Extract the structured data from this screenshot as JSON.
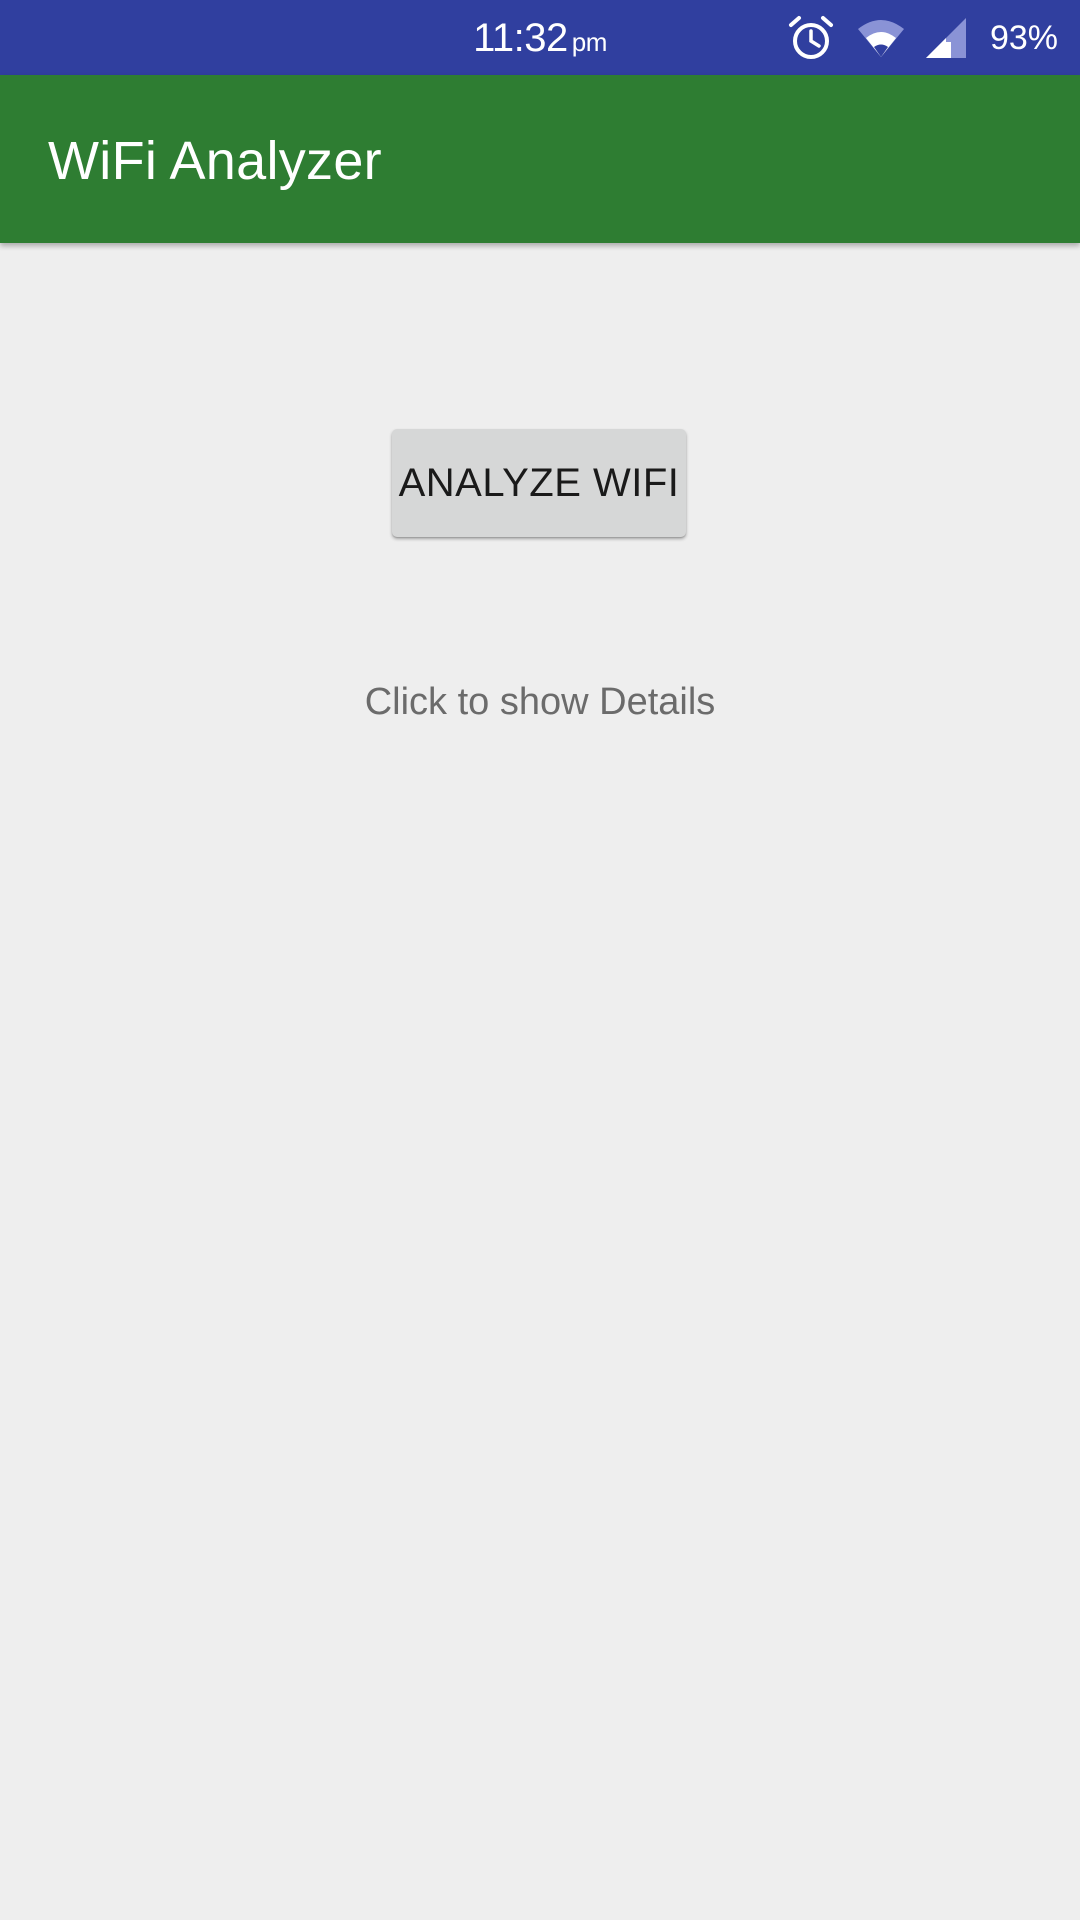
{
  "status_bar": {
    "time": "11:32",
    "ampm": "pm",
    "battery": "93%",
    "icons": [
      "alarm-clock-icon",
      "wifi-icon",
      "cell-signal-icon"
    ],
    "color": "#303f9f"
  },
  "app_bar": {
    "title": "WiFi Analyzer",
    "color": "#2e7d32"
  },
  "main": {
    "analyze_button_label": "ANALYZE WIFI",
    "details_text": "Click to show Details"
  }
}
